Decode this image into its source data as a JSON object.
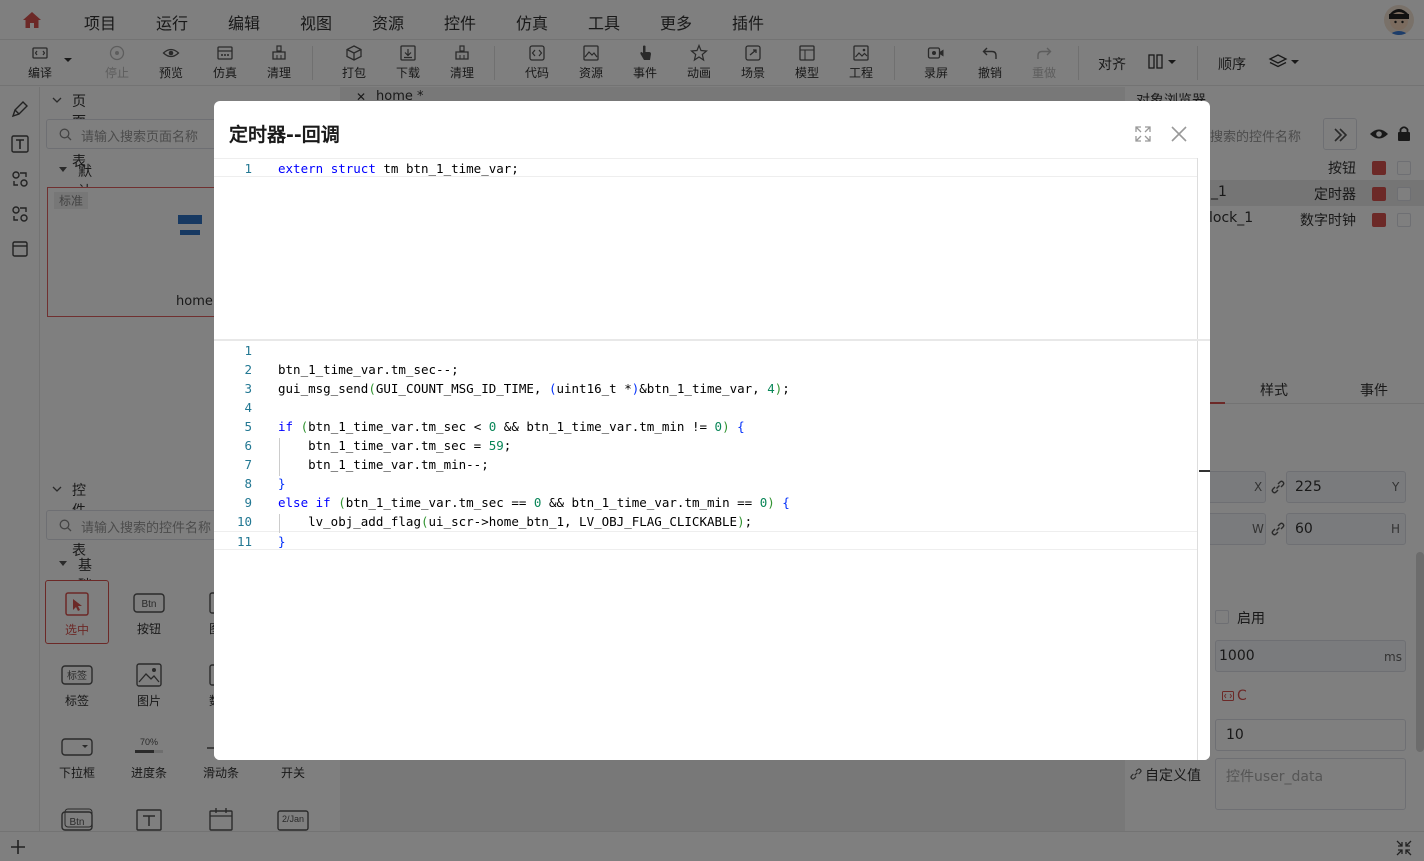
{
  "menu": {
    "items": [
      "项目",
      "运行",
      "编辑",
      "视图",
      "资源",
      "控件",
      "仿真",
      "工具",
      "更多",
      "插件"
    ]
  },
  "toolbar": {
    "buttons": [
      {
        "label": "编译",
        "icon": "compile-icon"
      },
      {
        "label": "停止",
        "icon": "stop-icon",
        "disabled": true
      },
      {
        "label": "预览",
        "icon": "preview-icon"
      },
      {
        "label": "仿真",
        "icon": "simulate-icon"
      },
      {
        "label": "清理",
        "icon": "clean-icon"
      },
      {
        "label": "打包",
        "icon": "package-icon"
      },
      {
        "label": "下载",
        "icon": "download-icon"
      },
      {
        "label": "清理",
        "icon": "clean-icon"
      },
      {
        "label": "代码",
        "icon": "code-icon"
      },
      {
        "label": "资源",
        "icon": "resource-icon"
      },
      {
        "label": "事件",
        "icon": "event-icon"
      },
      {
        "label": "动画",
        "icon": "animation-icon"
      },
      {
        "label": "场景",
        "icon": "scene-icon"
      },
      {
        "label": "模型",
        "icon": "model-icon"
      },
      {
        "label": "工程",
        "icon": "project-icon"
      },
      {
        "label": "录屏",
        "icon": "record-icon"
      },
      {
        "label": "撤销",
        "icon": "undo-icon"
      },
      {
        "label": "重做",
        "icon": "redo-icon",
        "disabled": true
      }
    ],
    "align_label": "对齐",
    "order_label": "顺序"
  },
  "left_panel": {
    "page_list_title": "页面列表",
    "page_search_placeholder": "请输入搜索页面名称",
    "group_default": "默认",
    "page_card": {
      "badge": "标准",
      "name": "home"
    },
    "widget_list_title": "控件列表",
    "widget_search_placeholder": "请输入搜索的控件名称",
    "basic_group": "基础控件",
    "widgets": [
      {
        "label": "选中",
        "icon": "select-icon"
      },
      {
        "label": "按钮",
        "icon": "button-widget-icon",
        "glyph": "Btn"
      },
      {
        "label": "图片",
        "icon": "image-button-icon"
      },
      {
        "label": "标签",
        "icon": "label-widget-icon",
        "glyph": "标签"
      },
      {
        "label": "图片",
        "icon": "image-widget-icon"
      },
      {
        "label": "数字",
        "icon": "digit-widget-icon"
      },
      {
        "label": "下拉框",
        "icon": "dropdown-widget-icon"
      },
      {
        "label": "进度条",
        "icon": "progress-widget-icon",
        "glyph": "70%"
      },
      {
        "label": "滑动条",
        "icon": "slider-widget-icon"
      },
      {
        "label": "开关",
        "icon": "switch-widget-icon"
      },
      {
        "label": "",
        "icon": "button-matrix-icon",
        "glyph": "Btn"
      },
      {
        "label": "",
        "icon": "textarea-widget-icon"
      },
      {
        "label": "",
        "icon": "calendar-widget-icon"
      },
      {
        "label": "",
        "icon": "date-widget-icon",
        "glyph": "2/Jan"
      }
    ]
  },
  "canvas": {
    "tab": "home *"
  },
  "right_panel": {
    "object_browser_title": "对象浏览器",
    "search_placeholder": "搜索的控件名称",
    "objects": [
      {
        "name": "",
        "type": "按钮"
      },
      {
        "name": "_1",
        "type": "定时器"
      },
      {
        "name": "lock_1",
        "type": "数字时钟"
      }
    ],
    "tabs": [
      "样式",
      "事件"
    ],
    "x_label": "X",
    "y_value": "225",
    "y_label": "Y",
    "w_label": "W",
    "h_value": "60",
    "h_label": "H",
    "enable_label": "启用",
    "period_value": "1000",
    "period_unit": "ms",
    "c_label": "C",
    "repeat_value": "10",
    "custom_label": "自定义值",
    "user_data_placeholder": "控件user_data"
  },
  "modal": {
    "title": "定时器--回调",
    "top_code": [
      {
        "n": "1",
        "tokens": [
          {
            "t": "extern",
            "c": "kw"
          },
          {
            "t": " "
          },
          {
            "t": "struct",
            "c": "kw"
          },
          {
            "t": " tm btn_1_time_var;"
          }
        ]
      }
    ],
    "bottom_code": [
      {
        "n": "1",
        "tokens": []
      },
      {
        "n": "2",
        "tokens": [
          {
            "t": "btn_1_time_var.tm_sec--;"
          }
        ]
      },
      {
        "n": "3",
        "tokens": [
          {
            "t": "gui_msg_send"
          },
          {
            "t": "(",
            "c": "paren"
          },
          {
            "t": "GUI_COUNT_MSG_ID_TIME, "
          },
          {
            "t": "(",
            "c": "brace"
          },
          {
            "t": "uint16_t *"
          },
          {
            "t": ")",
            "c": "brace"
          },
          {
            "t": "&btn_1_time_var, "
          },
          {
            "t": "4",
            "c": "num"
          },
          {
            "t": ")",
            "c": "paren"
          },
          {
            "t": ";"
          }
        ]
      },
      {
        "n": "4",
        "tokens": []
      },
      {
        "n": "5",
        "tokens": [
          {
            "t": "if",
            "c": "kw"
          },
          {
            "t": " "
          },
          {
            "t": "(",
            "c": "paren"
          },
          {
            "t": "btn_1_time_var.tm_sec < "
          },
          {
            "t": "0",
            "c": "num"
          },
          {
            "t": " && btn_1_time_var.tm_min != "
          },
          {
            "t": "0",
            "c": "num"
          },
          {
            "t": ")",
            "c": "paren"
          },
          {
            "t": " "
          },
          {
            "t": "{",
            "c": "brace"
          }
        ]
      },
      {
        "n": "6",
        "tokens": [
          {
            "t": "    btn_1_time_var.tm_sec = "
          },
          {
            "t": "59",
            "c": "num"
          },
          {
            "t": ";"
          }
        ]
      },
      {
        "n": "7",
        "tokens": [
          {
            "t": "    btn_1_time_var.tm_min--;"
          }
        ]
      },
      {
        "n": "8",
        "tokens": [
          {
            "t": "}",
            "c": "brace"
          }
        ]
      },
      {
        "n": "9",
        "tokens": [
          {
            "t": "else",
            "c": "kw"
          },
          {
            "t": " "
          },
          {
            "t": "if",
            "c": "kw"
          },
          {
            "t": " "
          },
          {
            "t": "(",
            "c": "paren"
          },
          {
            "t": "btn_1_time_var.tm_sec == "
          },
          {
            "t": "0",
            "c": "num"
          },
          {
            "t": " && btn_1_time_var.tm_min == "
          },
          {
            "t": "0",
            "c": "num"
          },
          {
            "t": ")",
            "c": "paren"
          },
          {
            "t": " "
          },
          {
            "t": "{",
            "c": "brace"
          }
        ]
      },
      {
        "n": "10",
        "tokens": [
          {
            "t": "    lv_obj_add_flag"
          },
          {
            "t": "(",
            "c": "paren"
          },
          {
            "t": "ui_scr->home_btn_1, LV_OBJ_FLAG_CLICKABLE"
          },
          {
            "t": ")",
            "c": "paren"
          },
          {
            "t": ";"
          }
        ]
      },
      {
        "n": "11",
        "tokens": [
          {
            "t": "}",
            "c": "brace"
          }
        ]
      }
    ]
  }
}
